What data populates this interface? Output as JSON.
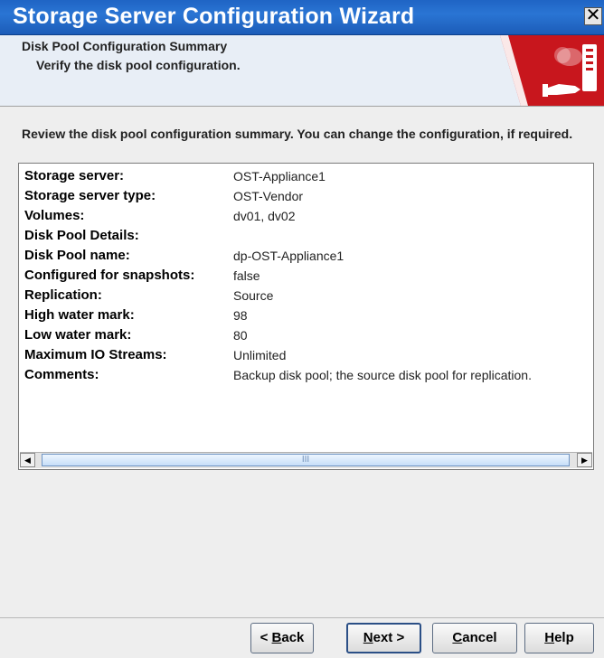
{
  "window": {
    "title": "Storage Server Configuration Wizard",
    "close_glyph": "✕"
  },
  "header": {
    "title": "Disk Pool Configuration Summary",
    "subtitle": "Verify the disk pool configuration.",
    "graphic_icon": "disk-pool-hand-icon",
    "accent_color": "#c8161d"
  },
  "intro": "Review the disk pool configuration summary. You can change the configuration, if required.",
  "summary": [
    {
      "label": "Storage server:",
      "value": "OST-Appliance1"
    },
    {
      "label": "Storage server type:",
      "value": "OST-Vendor"
    },
    {
      "label": "Volumes:",
      "value": "dv01, dv02"
    },
    {
      "label": "Disk Pool Details:",
      "value": ""
    },
    {
      "label": "Disk Pool name:",
      "value": "dp-OST-Appliance1"
    },
    {
      "label": "Configured for snapshots:",
      "value": "false"
    },
    {
      "label": "Replication:",
      "value": "Source"
    },
    {
      "label": "High water mark:",
      "value": "98"
    },
    {
      "label": "Low water mark:",
      "value": "80"
    },
    {
      "label": "Maximum IO Streams:",
      "value": "Unlimited"
    },
    {
      "label": "Comments:",
      "value": "Backup disk pool; the source disk pool for replication."
    }
  ],
  "scrollbar": {
    "left_arrow": "◀",
    "right_arrow": "▶",
    "grip": "III"
  },
  "buttons": {
    "back_prefix": "< ",
    "back_key": "B",
    "back_rest": "ack",
    "next_key": "N",
    "next_rest": "ext >",
    "cancel_key": "C",
    "cancel_rest": "ancel",
    "help_key": "H",
    "help_rest": "elp"
  }
}
